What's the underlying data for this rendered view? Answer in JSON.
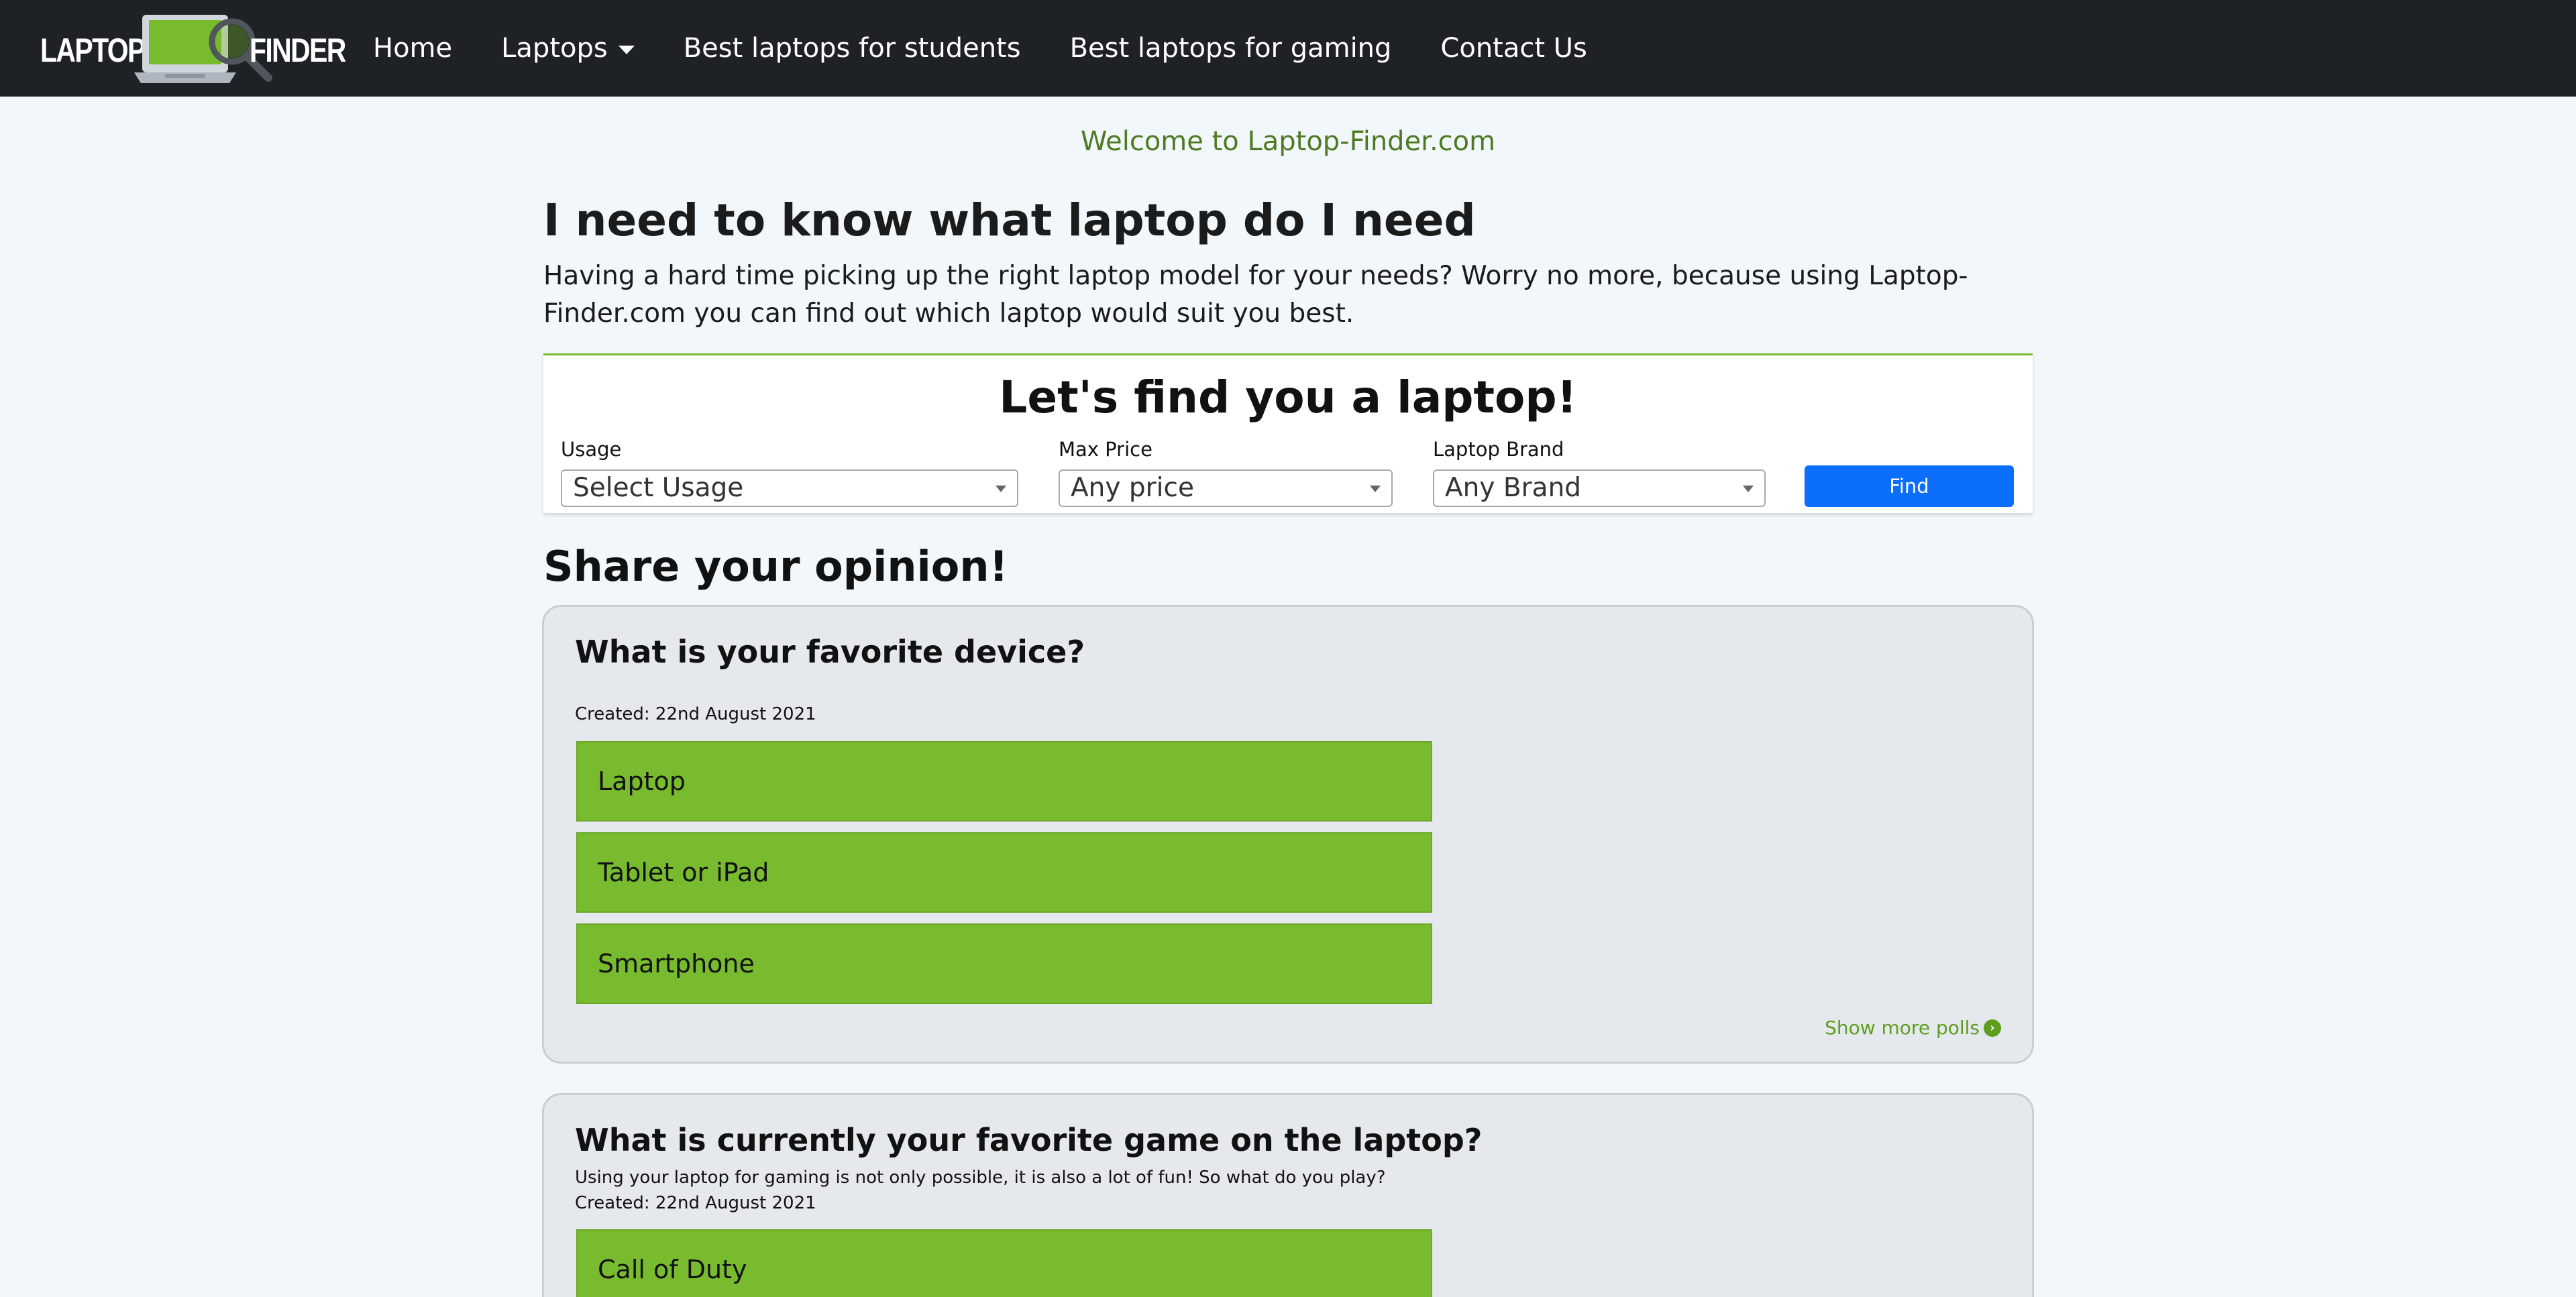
{
  "navbar": {
    "brand_left": "LAPTOP",
    "brand_right": "FINDER",
    "links": [
      {
        "label": "Home"
      },
      {
        "label": "Laptops",
        "has_dropdown": true
      },
      {
        "label": "Best laptops for students"
      },
      {
        "label": "Best laptops for gaming"
      },
      {
        "label": "Contact Us"
      }
    ]
  },
  "main": {
    "welcome": "Welcome to Laptop-Finder.com",
    "heading": "I need to know what laptop do I need",
    "intro": "Having a hard time picking up the right laptop model for your needs? Worry no more, because using Laptop-Finder.com you can find out which laptop would suit you best."
  },
  "finder": {
    "title": "Let's find you a laptop!",
    "usage_label": "Usage",
    "usage_value": "Select Usage",
    "price_label": "Max Price",
    "price_value": "Any price",
    "brand_label": "Laptop Brand",
    "brand_value": "Any Brand",
    "find_label": "Find"
  },
  "opinion": {
    "heading": "Share your opinion!",
    "polls": [
      {
        "title": "What is your favorite device?",
        "created": "Created: 22nd August 2021",
        "options": [
          "Laptop",
          "Tablet or iPad",
          "Smartphone"
        ],
        "more_label": "Show more polls"
      },
      {
        "title": "What is currently your favorite game on the laptop?",
        "description": "Using your laptop for gaming is not only possible, it is also a lot of fun! So what do you play?",
        "created": "Created: 22nd August 2021",
        "options": [
          "Call of Duty"
        ]
      }
    ]
  },
  "colors": {
    "navbar_bg": "#1e2226",
    "accent_green": "#79bb2f",
    "welcome_green": "#4d7b23",
    "button_blue": "#0b6efd",
    "page_bg": "#f2f7fb"
  }
}
